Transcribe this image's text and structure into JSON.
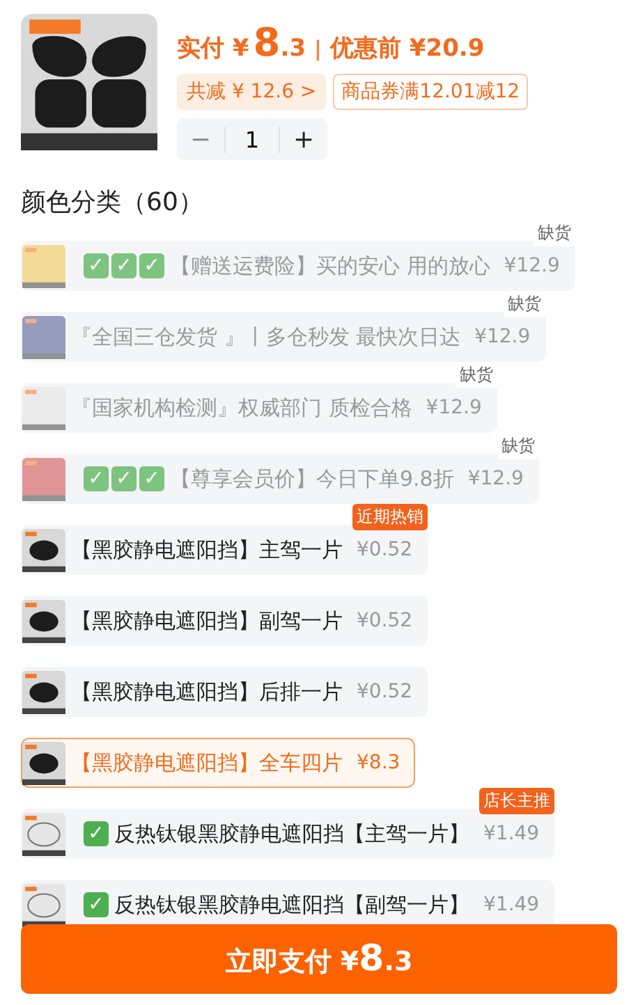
{
  "price": {
    "paid_label": "实付",
    "currency": "¥",
    "paid_int": "8",
    "paid_dec": ".3",
    "separator": "|",
    "before_label": "优惠前",
    "before_value": "¥20.9"
  },
  "discount": {
    "label": "共减 ¥ 12.6",
    "chevron": ">"
  },
  "coupon": "商品券满12.01减12",
  "stepper": {
    "minus": "−",
    "value": "1",
    "plus": "+",
    "minus_disabled": true
  },
  "section_title": "颜色分类（60）",
  "options": [
    {
      "marks": [
        "✓",
        "✓",
        "✓"
      ],
      "name": "【赠送运费险】买的安心 用的放心",
      "price": "¥12.9",
      "disabled": true,
      "selected": false,
      "tag": "缺货",
      "hot": false
    },
    {
      "name": "『全国三仓发货 』丨多仓秒发 最快次日达",
      "price": "¥12.9",
      "disabled": true,
      "selected": false,
      "tag": "缺货",
      "hot": false
    },
    {
      "name": "『国家机构检测』权威部门 质检合格",
      "price": "¥12.9",
      "disabled": true,
      "selected": false,
      "tag": "缺货",
      "hot": false
    },
    {
      "marks": [
        "✓",
        "✓",
        "✓"
      ],
      "name": "【尊享会员价】今日下单9.8折",
      "price": "¥12.9",
      "disabled": true,
      "selected": false,
      "tag": "缺货",
      "hot": false
    },
    {
      "name": "【黑胶静电遮阳挡】主驾一片",
      "price": "¥0.52",
      "disabled": false,
      "selected": false,
      "tag": "近期热销",
      "hot": true
    },
    {
      "name": "【黑胶静电遮阳挡】副驾一片",
      "price": "¥0.52",
      "disabled": false,
      "selected": false
    },
    {
      "name": "【黑胶静电遮阳挡】后排一片",
      "price": "¥0.52",
      "disabled": false,
      "selected": false
    },
    {
      "name": "【黑胶静电遮阳挡】全车四片",
      "price": "¥8.3",
      "disabled": false,
      "selected": true
    },
    {
      "marks": [
        "✓"
      ],
      "name": "反热钛银黑胶静电遮阳挡【主驾一片】",
      "price": "¥1.49",
      "disabled": false,
      "selected": false,
      "tag": "店长主推",
      "hot": true
    },
    {
      "marks": [
        "✓"
      ],
      "name": "反热钛银黑胶静电遮阳挡【副驾一片】",
      "price": "¥1.49",
      "disabled": false,
      "selected": false
    }
  ],
  "pay_button": {
    "label": "立即支付",
    "currency": "¥",
    "int": "8",
    "dec": ".3"
  }
}
